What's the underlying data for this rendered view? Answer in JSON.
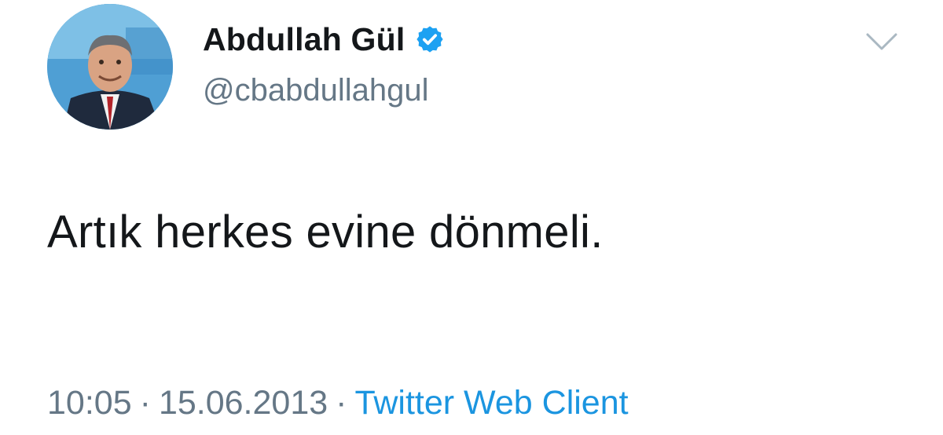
{
  "tweet": {
    "author": {
      "display_name": "Abdullah Gül",
      "handle": "@cbabdullahgul",
      "verified": true,
      "verified_icon": "verified-badge-icon",
      "avatar_icon": "avatar-photo"
    },
    "text": "Artık herkes evine dönmeli.",
    "time": "10:05",
    "date": "15.06.2013",
    "separator": "·",
    "source": "Twitter Web Client",
    "menu_icon": "chevron-down-icon"
  },
  "colors": {
    "text_primary": "#14171a",
    "text_secondary": "#657786",
    "link": "#1b95e0",
    "verified": "#1da1f2"
  }
}
